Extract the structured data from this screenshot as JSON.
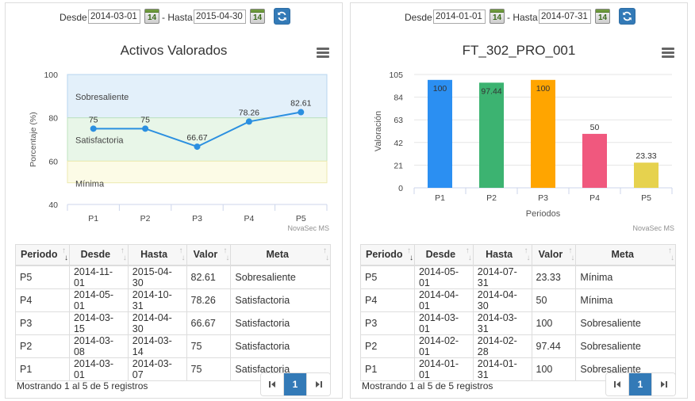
{
  "left": {
    "date_from_label": "Desde",
    "date_from": "2014-03-01",
    "date_to_label": "- Hasta",
    "date_to": "2015-04-30",
    "calendar_day": "14",
    "chart_title": "Activos Valorados",
    "credit": "NovaSec MS",
    "bands": [
      "Sobresaliente",
      "Satisfactoria",
      "Mínima"
    ],
    "columns": [
      "Periodo",
      "Desde",
      "Hasta",
      "Valor",
      "Meta"
    ],
    "rows": [
      [
        "P5",
        "2014-11-01",
        "2015-04-30",
        "82.61",
        "Sobresaliente"
      ],
      [
        "P4",
        "2014-05-01",
        "2014-10-31",
        "78.26",
        "Satisfactoria"
      ],
      [
        "P3",
        "2014-03-15",
        "2014-04-30",
        "66.67",
        "Satisfactoria"
      ],
      [
        "P2",
        "2014-03-08",
        "2014-03-14",
        "75",
        "Satisfactoria"
      ],
      [
        "P1",
        "2014-03-01",
        "2014-03-07",
        "75",
        "Satisfactoria"
      ]
    ],
    "info": "Mostrando 1 al 5 de 5 registros",
    "page": "1"
  },
  "right": {
    "date_from_label": "Desde",
    "date_from": "2014-01-01",
    "date_to_label": "- Hasta",
    "date_to": "2014-07-31",
    "calendar_day": "14",
    "chart_title": "FT_302_PRO_001",
    "credit": "NovaSec MS",
    "columns": [
      "Periodo",
      "Desde",
      "Hasta",
      "Valor",
      "Meta"
    ],
    "rows": [
      [
        "P5",
        "2014-05-01",
        "2014-07-31",
        "23.33",
        "Mínima"
      ],
      [
        "P4",
        "2014-04-01",
        "2014-04-30",
        "50",
        "Mínima"
      ],
      [
        "P3",
        "2014-03-01",
        "2014-03-31",
        "100",
        "Sobresaliente"
      ],
      [
        "P2",
        "2014-02-01",
        "2014-02-28",
        "97.44",
        "Sobresaliente"
      ],
      [
        "P1",
        "2014-01-01",
        "2014-01-31",
        "100",
        "Sobresaliente"
      ]
    ],
    "info": "Mostrando 1 al 5 de 5 registros",
    "page": "1"
  },
  "chart_data": [
    {
      "type": "line",
      "title": "Activos Valorados",
      "ylabel": "Porcentaje (%)",
      "xlabel": "",
      "categories": [
        "P1",
        "P2",
        "P3",
        "P4",
        "P5"
      ],
      "values": [
        75,
        75,
        66.67,
        78.26,
        82.61
      ],
      "ylim": [
        40,
        100
      ],
      "yticks": [
        40,
        60,
        80,
        100
      ],
      "series_color": "#2b8fe0",
      "bands": [
        {
          "label": "Sobresaliente",
          "from": 80,
          "to": 100,
          "color": "#e3f0fa"
        },
        {
          "label": "Satisfactoria",
          "from": 60,
          "to": 80,
          "color": "#e8f6e8"
        },
        {
          "label": "Mínima",
          "from": 50,
          "to": 60,
          "color": "#fcfbe6"
        }
      ]
    },
    {
      "type": "bar",
      "title": "FT_302_PRO_001",
      "ylabel": "Valoración",
      "xlabel": "Periodos",
      "categories": [
        "P1",
        "P2",
        "P3",
        "P4",
        "P5"
      ],
      "values": [
        100,
        97.44,
        100,
        50,
        23.33
      ],
      "ylim": [
        0,
        105
      ],
      "yticks": [
        0,
        21,
        42,
        63,
        84,
        105
      ],
      "colors": [
        "#2b8ff2",
        "#3cb371",
        "#ffa500",
        "#f0587e",
        "#e6d24e"
      ],
      "grid": true
    }
  ]
}
